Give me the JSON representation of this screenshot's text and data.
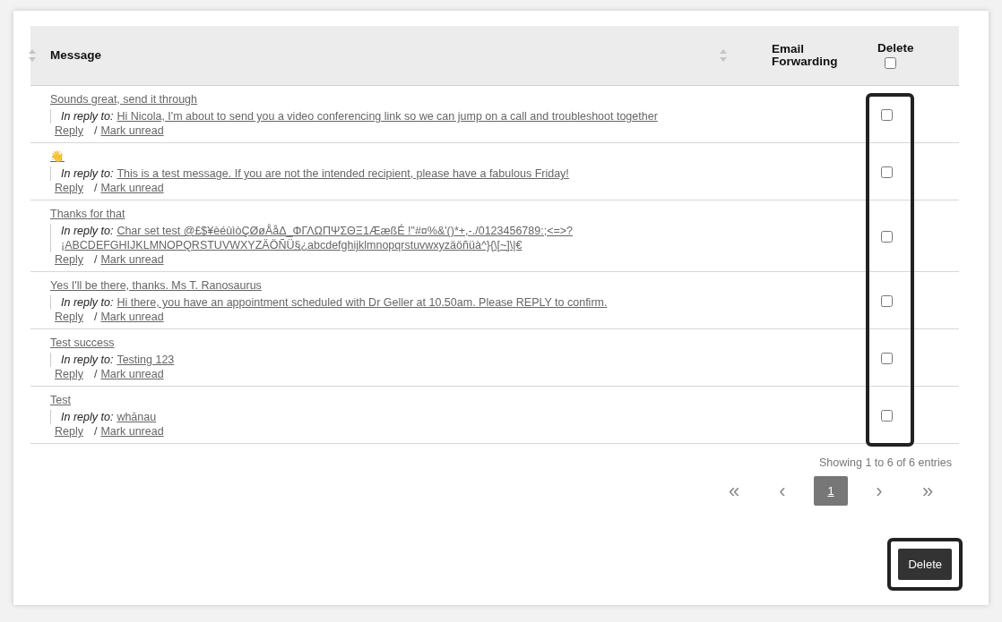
{
  "table": {
    "columns": [
      {
        "label": "Message",
        "sortable": true
      },
      {
        "label": "Email Forwarding",
        "sortable": true
      },
      {
        "label": "Delete",
        "sortable": false
      }
    ],
    "select_all": {
      "checked": false
    },
    "rows": [
      {
        "message": "Sounds great, send it through",
        "reply_label": "In reply to:",
        "in_reply_to": [
          "Hi Nicola, I'm about to send you a video conferencing link so we can jump on a call and troubleshoot together"
        ],
        "reply": "Reply",
        "separator": "/",
        "mark_unread": "Mark unread",
        "checked": false
      },
      {
        "message": "👋",
        "reply_label": "In reply to:",
        "in_reply_to": [
          "This is a test message. If you are not the intended recipient, please have a fabulous Friday!"
        ],
        "reply": "Reply",
        "separator": "/",
        "mark_unread": "Mark unread",
        "checked": false
      },
      {
        "message": "Thanks for that",
        "reply_label": "In reply to:",
        "in_reply_to": [
          "Char set test @£$¥èéùìòÇØøÅåΔ_ΦΓΛΩΠΨΣΘΞ1ÆæßÉ !\"#¤%&'()*+,-./0123456789:;<=>?",
          "¡ABCDEFGHIJKLMNOPQRSTUVWXYZÄÖÑÜ§¿abcdefghijklmnopqrstuvwxyzäöñüà^}{\\[~]\\|€"
        ],
        "reply": "Reply",
        "separator": "/",
        "mark_unread": "Mark unread",
        "checked": false
      },
      {
        "message": "Yes I'll be there, thanks. Ms T. Ranosaurus",
        "reply_label": "In reply to:",
        "in_reply_to": [
          "Hi there, you have an appointment scheduled with Dr Geller at 10.50am. Please REPLY to confirm."
        ],
        "reply": "Reply",
        "separator": "/",
        "mark_unread": "Mark unread",
        "checked": false
      },
      {
        "message": "Test success",
        "reply_label": "In reply to:",
        "in_reply_to": [
          "Testing 123"
        ],
        "reply": "Reply",
        "separator": "/",
        "mark_unread": "Mark unread",
        "checked": false
      },
      {
        "message": "Test",
        "reply_label": "In reply to:",
        "in_reply_to": [
          "whānau"
        ],
        "reply": "Reply",
        "separator": "/",
        "mark_unread": "Mark unread",
        "checked": false
      }
    ],
    "delete_column_highlighted": true
  },
  "info": "Showing 1 to 6 of 6 entries",
  "pagination": [
    {
      "label": "«",
      "kind": "first",
      "selected": false
    },
    {
      "label": "‹",
      "kind": "prev",
      "selected": false
    },
    {
      "label": "1",
      "kind": "page",
      "selected": true
    },
    {
      "label": "›",
      "kind": "next",
      "selected": false
    },
    {
      "label": "»",
      "kind": "last",
      "selected": false
    }
  ],
  "delete_button": {
    "label": "Delete",
    "highlighted": true
  }
}
